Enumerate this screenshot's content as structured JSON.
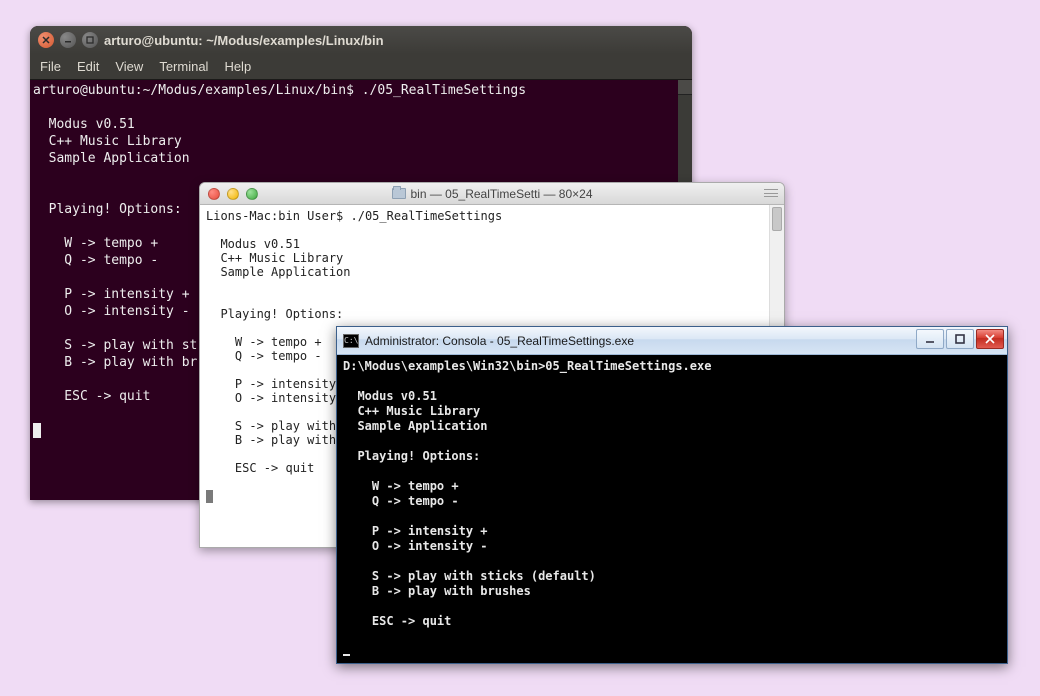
{
  "ubuntu": {
    "title": "arturo@ubuntu: ~/Modus/examples/Linux/bin",
    "menus": [
      "File",
      "Edit",
      "View",
      "Terminal",
      "Help"
    ],
    "prompt": "arturo@ubuntu:~/Modus/examples/Linux/bin$ ./05_RealTimeSettings",
    "output": "\n  Modus v0.51\n  C++ Music Library\n  Sample Application\n\n\n  Playing! Options:\n\n    W -> tempo +\n    Q -> tempo -\n\n    P -> intensity +\n    O -> intensity -\n\n    S -> play with st\n    B -> play with br\n\n    ESC -> quit\n"
  },
  "mac": {
    "title": "bin — 05_RealTimeSetti — 80×24",
    "prompt": "Lions-Mac:bin User$ ./05_RealTimeSettings",
    "output": "\n  Modus v0.51\n  C++ Music Library\n  Sample Application\n\n\n  Playing! Options:\n\n    W -> tempo +\n    Q -> tempo -\n\n    P -> intensity\n    O -> intensity\n\n    S -> play with\n    B -> play with\n\n    ESC -> quit\n"
  },
  "win": {
    "title": "Administrator: Consola - 05_RealTimeSettings.exe",
    "prompt": "D:\\Modus\\examples\\Win32\\bin>05_RealTimeSettings.exe",
    "output": "\n  Modus v0.51\n  C++ Music Library\n  Sample Application\n\n  Playing! Options:\n\n    W -> tempo +\n    Q -> tempo -\n\n    P -> intensity +\n    O -> intensity -\n\n    S -> play with sticks (default)\n    B -> play with brushes\n\n    ESC -> quit\n"
  }
}
